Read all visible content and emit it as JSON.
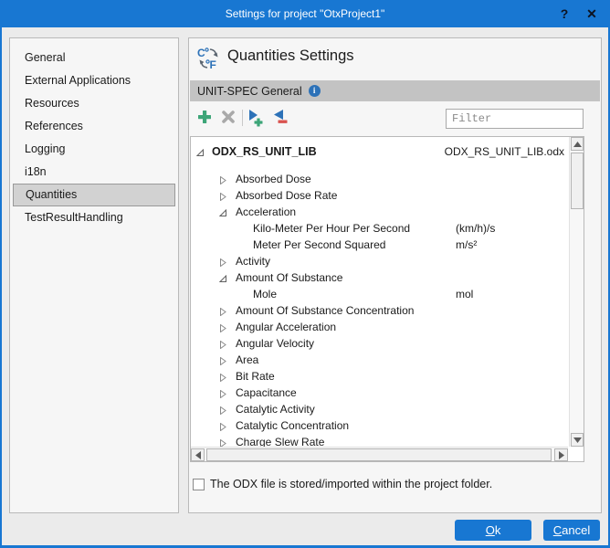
{
  "window": {
    "title": "Settings for project \"OtxProject1\"",
    "help_label": "?",
    "close_label": "✕"
  },
  "sidebar": {
    "items": [
      {
        "label": "General",
        "selected": false
      },
      {
        "label": "External Applications",
        "selected": false
      },
      {
        "label": "Resources",
        "selected": false
      },
      {
        "label": "References",
        "selected": false
      },
      {
        "label": "Logging",
        "selected": false
      },
      {
        "label": "i18n",
        "selected": false
      },
      {
        "label": "Quantities",
        "selected": true
      },
      {
        "label": "TestResultHandling",
        "selected": false
      }
    ]
  },
  "main": {
    "title": "Quantities Settings",
    "section": {
      "label": "UNIT-SPEC General",
      "info_icon": "i"
    },
    "toolbar": {
      "icons": [
        "add-icon",
        "delete-icon",
        "import-unitspec-icon",
        "remove-unitspec-icon"
      ],
      "filter_placeholder": "Filter"
    },
    "tree": {
      "rows": [
        {
          "level": 0,
          "expander": "expanded",
          "label": "ODX_RS_UNIT_LIB",
          "bold": true,
          "value": "ODX_RS_UNIT_LIB.odx",
          "value_right": true
        },
        {
          "level": 1,
          "expander": "collapsed",
          "label": "Absorbed Dose"
        },
        {
          "level": 1,
          "expander": "collapsed",
          "label": "Absorbed Dose Rate"
        },
        {
          "level": 1,
          "expander": "expanded",
          "label": "Acceleration"
        },
        {
          "level": 2,
          "expander": null,
          "label": "Kilo-Meter Per Hour Per Second",
          "value": "(km/h)/s"
        },
        {
          "level": 2,
          "expander": null,
          "label": "Meter Per Second Squared",
          "value": "m/s²"
        },
        {
          "level": 1,
          "expander": "collapsed",
          "label": "Activity"
        },
        {
          "level": 1,
          "expander": "expanded",
          "label": "Amount Of Substance"
        },
        {
          "level": 2,
          "expander": null,
          "label": "Mole",
          "value": "mol"
        },
        {
          "level": 1,
          "expander": "collapsed",
          "label": "Amount Of Substance Concentration"
        },
        {
          "level": 1,
          "expander": "collapsed",
          "label": "Angular Acceleration"
        },
        {
          "level": 1,
          "expander": "collapsed",
          "label": "Angular Velocity"
        },
        {
          "level": 1,
          "expander": "collapsed",
          "label": "Area"
        },
        {
          "level": 1,
          "expander": "collapsed",
          "label": "Bit Rate"
        },
        {
          "level": 1,
          "expander": "collapsed",
          "label": "Capacitance"
        },
        {
          "level": 1,
          "expander": "collapsed",
          "label": "Catalytic Activity"
        },
        {
          "level": 1,
          "expander": "collapsed",
          "label": "Catalytic Concentration"
        },
        {
          "level": 1,
          "expander": "collapsed",
          "label": "Charge Slew Rate"
        }
      ]
    },
    "checkbox": {
      "label": "The ODX file is stored/imported within the project folder.",
      "checked": false
    }
  },
  "footer": {
    "ok_label": "Ok",
    "cancel_label": "Cancel"
  },
  "colors": {
    "accent_blue": "#1877d2",
    "icon_blue": "#2d72b8",
    "icon_green": "#3da578",
    "icon_red": "#d9534f",
    "icon_gray": "#a9a9a9",
    "section_bar": "#c3c3c3",
    "selected_item": "#d2d2d2",
    "dialog_bg": "#ebebeb",
    "panel_bg": "#f6f6f6"
  }
}
